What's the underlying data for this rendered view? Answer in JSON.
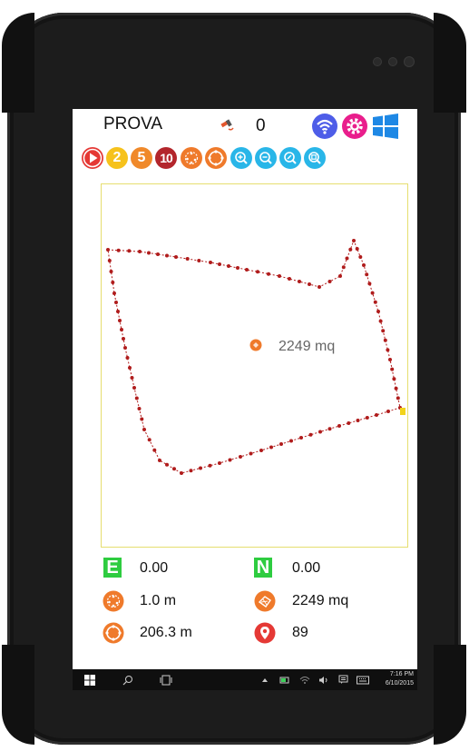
{
  "app": {
    "title": "PROVA",
    "satellite_count": "0"
  },
  "toolbar_top": {
    "icons": [
      "wifi-icon",
      "settings-gear-icon",
      "windows-icon"
    ]
  },
  "toolbar": {
    "buttons": [
      {
        "name": "play-button",
        "label": "",
        "color": "#e53935"
      },
      {
        "name": "interval-2-button",
        "label": "2",
        "color": "#f6c21c"
      },
      {
        "name": "interval-5-button",
        "label": "5",
        "color": "#f0892a"
      },
      {
        "name": "interval-10-button",
        "label": "10",
        "color": "#b3262c"
      },
      {
        "name": "point-accuracy-button",
        "label": "",
        "color": "#ef7a2b"
      },
      {
        "name": "perimeter-button",
        "label": "",
        "color": "#ef7a2b"
      },
      {
        "name": "zoom-in-button",
        "label": "",
        "color": "#29b6e8"
      },
      {
        "name": "zoom-out-button",
        "label": "",
        "color": "#29b6e8"
      },
      {
        "name": "zoom-fit-button",
        "label": "",
        "color": "#29b6e8"
      },
      {
        "name": "zoom-extent-button",
        "label": "",
        "color": "#29b6e8"
      }
    ]
  },
  "map": {
    "area_label": "2249 mq",
    "border_color": "#e6de6f",
    "track_color": "#b01c1c"
  },
  "stats": {
    "easting_badge": "E",
    "easting": "0.00",
    "northing_badge": "N",
    "northing": "0.00",
    "accuracy": "1.0 m",
    "area": "2249 mq",
    "perimeter": "206.3 m",
    "points": "89"
  },
  "taskbar": {
    "time": "7:16 PM",
    "date": "6/10/2015"
  }
}
